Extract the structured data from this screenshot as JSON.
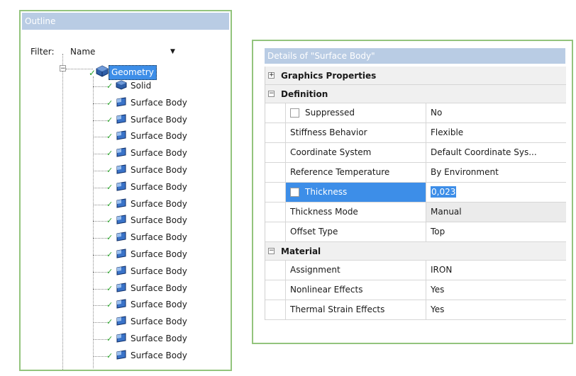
{
  "outline": {
    "title": "Outline",
    "filter_label": "Filter:",
    "filter_value": "Name",
    "root": {
      "label": "Geometry",
      "icon": "geometry-icon"
    },
    "children": [
      {
        "label": "Solid",
        "icon": "solid-body-icon"
      },
      {
        "label": "Surface Body",
        "icon": "surface-body-icon"
      },
      {
        "label": "Surface Body",
        "icon": "surface-body-icon"
      },
      {
        "label": "Surface Body",
        "icon": "surface-body-icon"
      },
      {
        "label": "Surface Body",
        "icon": "surface-body-icon"
      },
      {
        "label": "Surface Body",
        "icon": "surface-body-icon"
      },
      {
        "label": "Surface Body",
        "icon": "surface-body-icon"
      },
      {
        "label": "Surface Body",
        "icon": "surface-body-icon"
      },
      {
        "label": "Surface Body",
        "icon": "surface-body-icon"
      },
      {
        "label": "Surface Body",
        "icon": "surface-body-icon"
      },
      {
        "label": "Surface Body",
        "icon": "surface-body-icon"
      },
      {
        "label": "Surface Body",
        "icon": "surface-body-icon"
      },
      {
        "label": "Surface Body",
        "icon": "surface-body-icon"
      },
      {
        "label": "Surface Body",
        "icon": "surface-body-icon"
      },
      {
        "label": "Surface Body",
        "icon": "surface-body-icon"
      },
      {
        "label": "Surface Body",
        "icon": "surface-body-icon"
      },
      {
        "label": "Surface Body",
        "icon": "surface-body-icon"
      }
    ]
  },
  "details": {
    "title": "Details of \"Surface Body\"",
    "sections": [
      {
        "title": "Graphics Properties",
        "expanded": false,
        "rows": []
      },
      {
        "title": "Definition",
        "expanded": true,
        "rows": [
          {
            "name": "Suppressed",
            "value": "No",
            "checkbox": true
          },
          {
            "name": "Stiffness Behavior",
            "value": "Flexible"
          },
          {
            "name": "Coordinate System",
            "value": "Default Coordinate Sys..."
          },
          {
            "name": "Reference Temperature",
            "value": "By Environment"
          },
          {
            "name": "Thickness",
            "value": "0,023",
            "checkbox": true,
            "highlighted": true
          },
          {
            "name": "Thickness Mode",
            "value": "Manual",
            "gray": true
          },
          {
            "name": "Offset Type",
            "value": "Top"
          }
        ]
      },
      {
        "title": "Material",
        "expanded": true,
        "rows": [
          {
            "name": "Assignment",
            "value": "IRON"
          },
          {
            "name": "Nonlinear Effects",
            "value": "Yes"
          },
          {
            "name": "Thermal Strain Effects",
            "value": "Yes"
          }
        ]
      }
    ]
  },
  "colors": {
    "accent": "#3d8ee8",
    "titlebar": "#b9cce4",
    "frame": "#93c47d",
    "check": "#2aa22a"
  }
}
